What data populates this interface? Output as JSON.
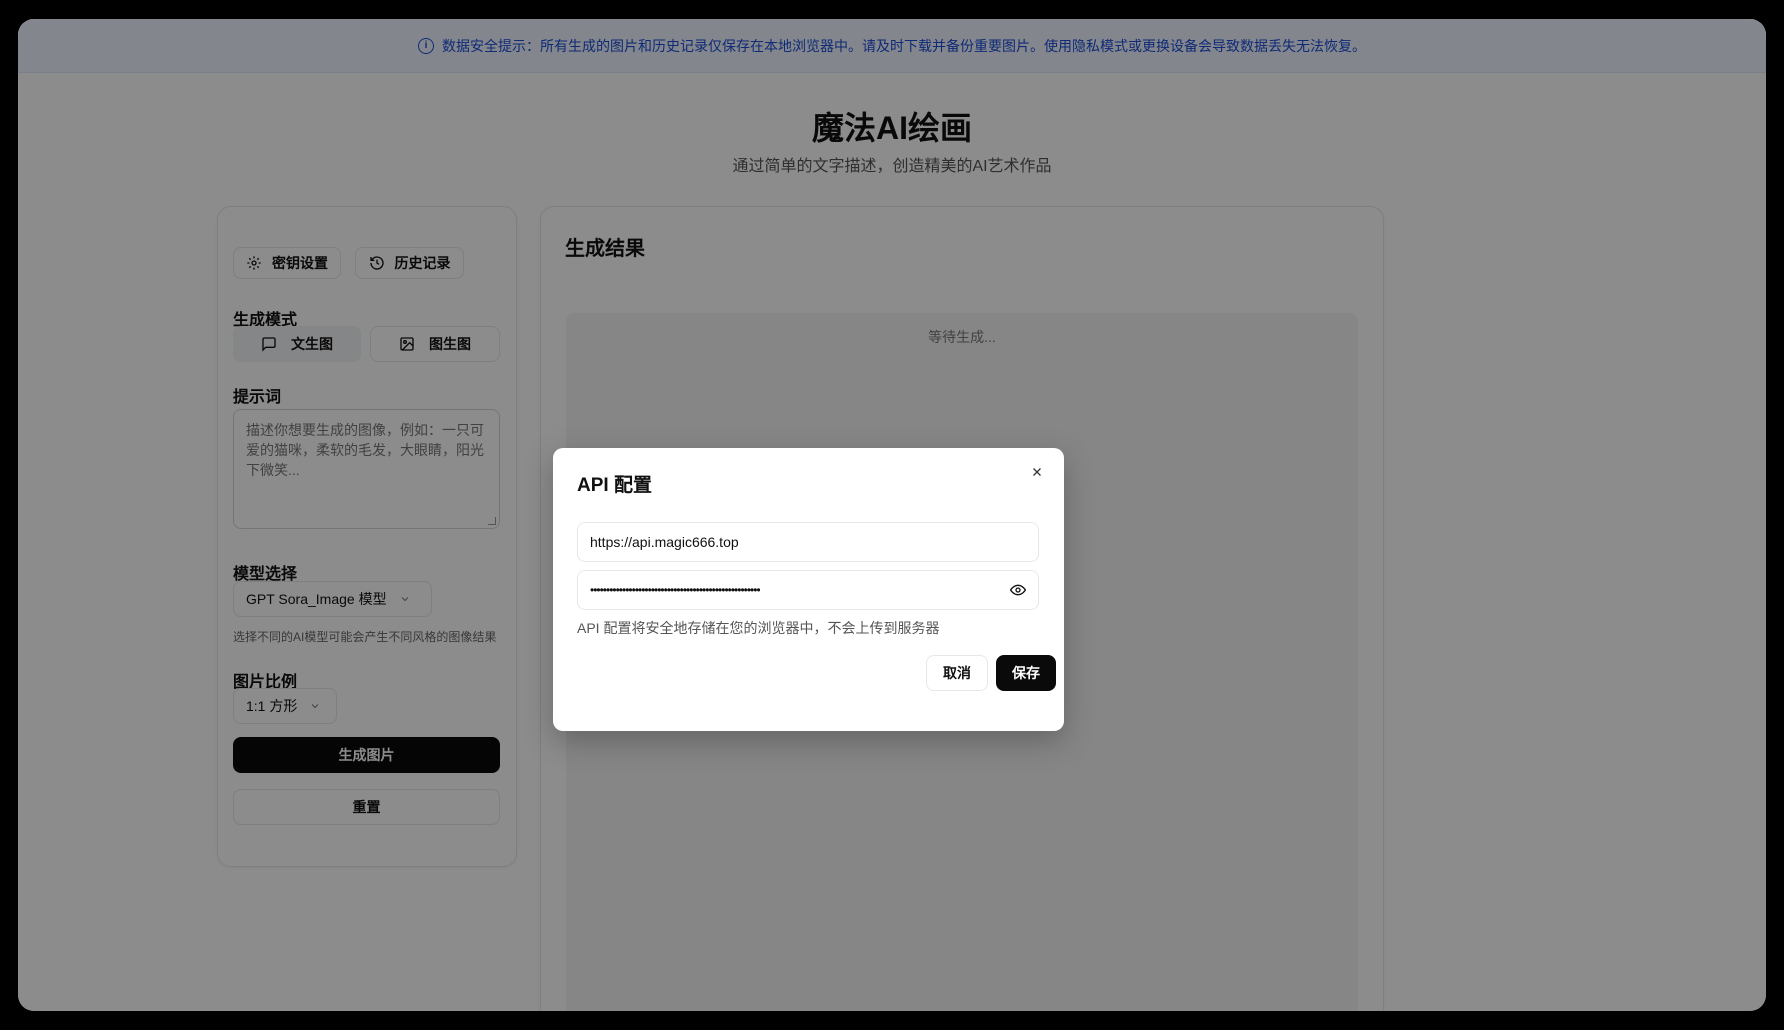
{
  "banner": {
    "text": "数据安全提示：所有生成的图片和历史记录仅保存在本地浏览器中。请及时下载并备份重要图片。使用隐私模式或更换设备会导致数据丢失无法恢复。",
    "icon": "info-icon"
  },
  "header": {
    "title": "魔法AI绘画",
    "subtitle": "通过简单的文字描述，创造精美的AI艺术作品"
  },
  "sidebar": {
    "key_settings_label": "密钥设置",
    "history_label": "历史记录",
    "mode_heading": "生成模式",
    "modes": [
      {
        "label": "文生图",
        "icon": "message-square-icon",
        "active": true
      },
      {
        "label": "图生图",
        "icon": "image-icon",
        "active": false
      }
    ],
    "prompt_heading": "提示词",
    "prompt_placeholder": "描述你想要生成的图像，例如：一只可爱的猫咪，柔软的毛发，大眼睛，阳光下微笑...",
    "model_heading": "模型选择",
    "model_value": "GPT Sora_Image 模型",
    "model_hint": "选择不同的AI模型可能会产生不同风格的图像结果",
    "ratio_heading": "图片比例",
    "ratio_value": "1:1 方形",
    "generate_label": "生成图片",
    "reset_label": "重置"
  },
  "result": {
    "title": "生成结果",
    "waiting_text": "等待生成..."
  },
  "modal": {
    "title": "API 配置",
    "url_value": "https://api.magic666.top",
    "key_value": "•••••••••••••••••••••••••••••••••••••••••••••••••••••",
    "note": "API 配置将安全地存储在您的浏览器中，不会上传到服务器",
    "cancel_label": "取消",
    "save_label": "保存"
  },
  "colors": {
    "primary": "#0a0a0a",
    "banner_text": "#1d4ed8",
    "banner_bg": "#eef4ff"
  }
}
